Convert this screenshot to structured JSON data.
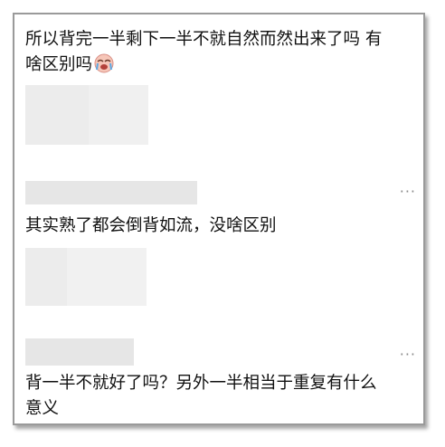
{
  "comments": [
    {
      "text_line1": "所以背完一半剩下一半不就自然而然出来了吗 有",
      "text_line2": "啥区别吗",
      "emoji": "crying-face-icon"
    },
    {
      "text": "其实熟了都会倒背如流，没啥区别",
      "more_label": "···"
    },
    {
      "text_line1": "背一半不就好了吗？另外一半相当于重复有什么",
      "text_line2": "意义",
      "more_label": "···"
    }
  ]
}
